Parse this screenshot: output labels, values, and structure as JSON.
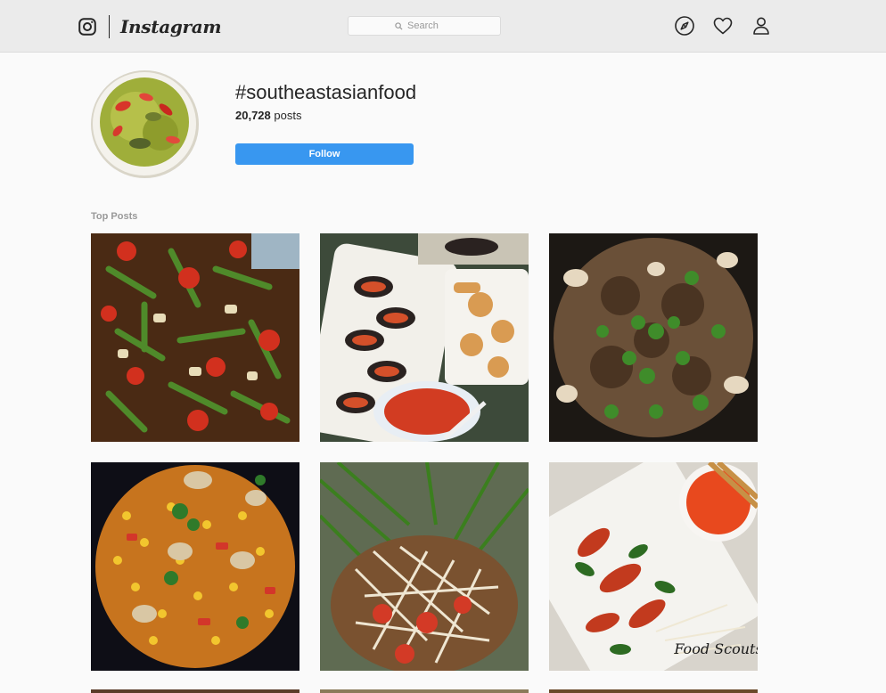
{
  "app": {
    "wordmark": "Instagram",
    "icons": [
      "instagram-glyph-icon",
      "explore-compass-icon",
      "heart-icon",
      "profile-icon",
      "search-icon"
    ]
  },
  "search": {
    "placeholder": "Search"
  },
  "hashtag": {
    "title": "#southeastasianfood",
    "post_count": "20,728",
    "post_count_suffix": "posts",
    "follow_label": "Follow",
    "profile_image": "green curry dish with red chili"
  },
  "sections": {
    "top_posts_label": "Top Posts"
  },
  "posts": [
    {
      "image": "green bean and tomato salad"
    },
    {
      "image": "mussels platter with fried rolls and dipping sauce"
    },
    {
      "image": "stir-fried meat with cilantro"
    },
    {
      "image": "corn and mushroom stir-fry"
    },
    {
      "image": "papaya salad with morning glory"
    },
    {
      "image": "shredded herbs salad with dipping sauce",
      "caption": "Food Scouts"
    }
  ],
  "colors": {
    "accent": "#3897f0",
    "topbar": "#ebebeb",
    "background": "#fafafa",
    "muted_text": "#999999"
  }
}
